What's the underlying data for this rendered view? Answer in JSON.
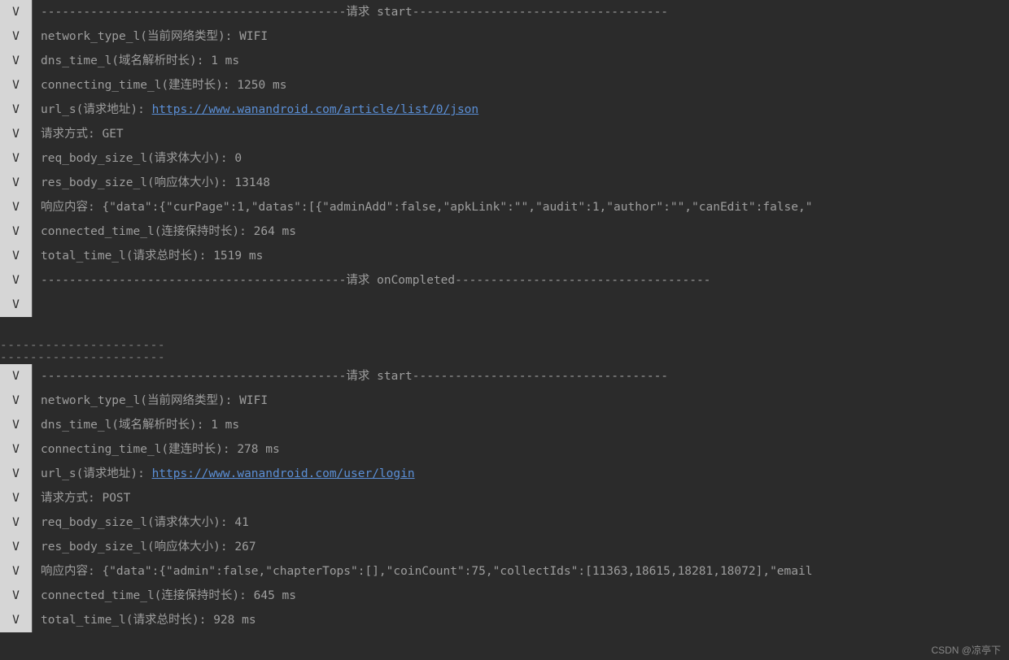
{
  "log_level": "V",
  "separators": {
    "start": "-------------------------------------------请求 start------------------------------------",
    "completed": "-------------------------------------------请求 onCompleted------------------------------------",
    "gap": "----------------------"
  },
  "labels": {
    "network_type": "network_type_l(当前网络类型): ",
    "dns_time": "dns_time_l(域名解析时长): ",
    "connecting_time": "connecting_time_l(建连时长): ",
    "url": "url_s(请求地址): ",
    "method": "请求方式: ",
    "req_body_size": "req_body_size_l(请求体大小): ",
    "res_body_size": "res_body_size_l(响应体大小): ",
    "response_content": "响应内容: ",
    "connected_time": "connected_time_l(连接保持时长): ",
    "total_time": "total_time_l(请求总时长): "
  },
  "request1": {
    "network_type": " WIFI",
    "dns_time": "1 ms",
    "connecting_time": "1250 ms",
    "url": "https://www.wanandroid.com/article/list/0/json",
    "method": "GET",
    "req_body_size": "0",
    "res_body_size": "13148",
    "response_content": "{\"data\":{\"curPage\":1,\"datas\":[{\"adminAdd\":false,\"apkLink\":\"\",\"audit\":1,\"author\":\"\",\"canEdit\":false,\"",
    "connected_time": "264 ms",
    "total_time": "1519 ms"
  },
  "request2": {
    "network_type": " WIFI",
    "dns_time": "1 ms",
    "connecting_time": "278 ms",
    "url": "https://www.wanandroid.com/user/login",
    "method": "POST",
    "req_body_size": "41",
    "res_body_size": "267",
    "response_content": "{\"data\":{\"admin\":false,\"chapterTops\":[],\"coinCount\":75,\"collectIds\":[11363,18615,18281,18072],\"email",
    "connected_time": "645 ms",
    "total_time": "928 ms"
  },
  "watermark": "CSDN @凉亭下"
}
